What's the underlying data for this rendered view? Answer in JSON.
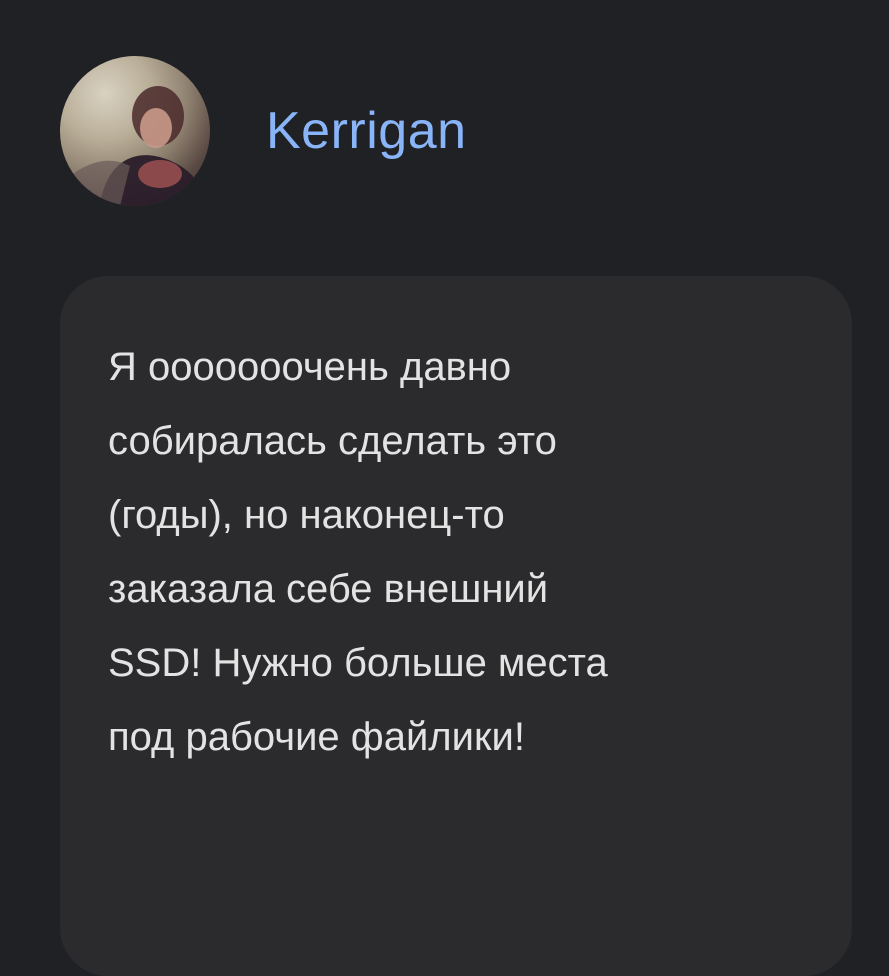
{
  "author": {
    "name": "Kerrigan",
    "avatar_icon": "user-avatar-photo"
  },
  "message": {
    "text": "Я ооооооочень давно\nсобиралась сделать это\n(годы), но наконец-то\nзаказала себе внешний\nSSD! Нужно больше места\nпод рабочие файлики!"
  },
  "colors": {
    "background": "#202124",
    "card": "#2b2b2d",
    "name": "#8ab4f8",
    "text": "#e3e3e3"
  }
}
